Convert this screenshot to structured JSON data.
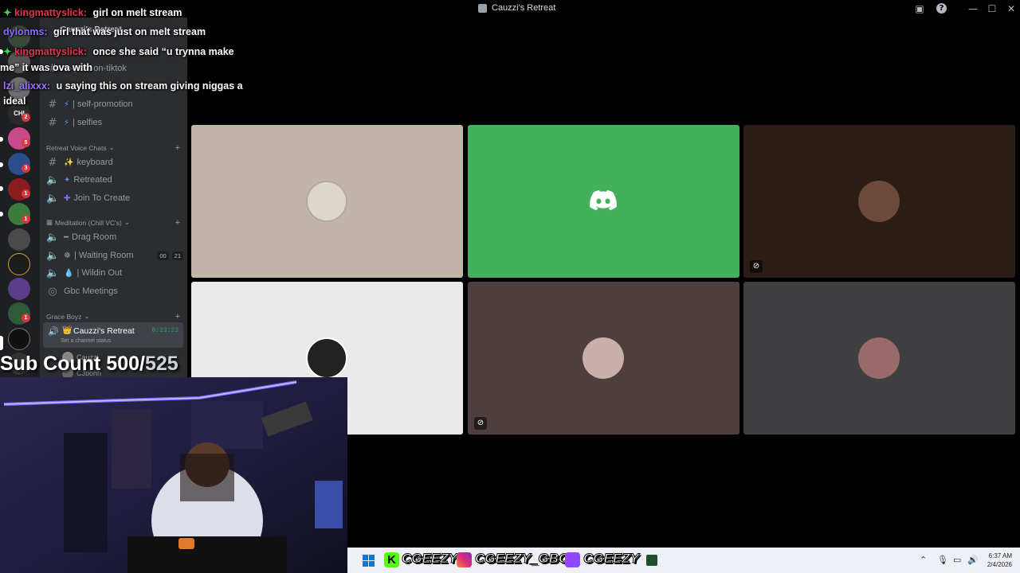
{
  "window": {
    "title": "Cauzzi's Retreat",
    "controls": {
      "minimize": "—",
      "maximize": "☐",
      "close": "✕"
    }
  },
  "rail": {
    "badges": [
      "2",
      "5",
      "3",
      "1",
      "1",
      "1"
    ]
  },
  "sidebar": {
    "server_name": "Cauzzi's Retreat",
    "channels_top": [
      {
        "label": "to-post-on-tiktok"
      },
      {
        "label": "| self-promotion"
      },
      {
        "label": "| selfies"
      }
    ],
    "category_voice": "Retreat Voice Chats",
    "voice_channels": [
      {
        "label": "keyboard"
      },
      {
        "label": "Retreated"
      },
      {
        "label": "Join To Create"
      }
    ],
    "category_meditation": "Meditation (Chill VC's)",
    "meditation_channels": [
      {
        "label": "Drag Room"
      },
      {
        "label": "| Waiting Room",
        "count_a": "00",
        "count_b": "21"
      },
      {
        "label": "| Wildin Out"
      },
      {
        "label": "Gbc Meetings"
      }
    ],
    "category_grace": "Grace Boyz",
    "active_channel": {
      "label": "Cauzzi's Retreat",
      "timer": "8:23:23",
      "status": "Set a channel status"
    },
    "members": [
      "Cauzzi",
      "CJbohh"
    ]
  },
  "chat": [
    {
      "user": "kingmattyslick:",
      "msg": "girl on melt stream",
      "color": "#e8334d"
    },
    {
      "user": "dylonms:",
      "msg": "girl that was just on melt stream",
      "color": "#8b6cff"
    },
    {
      "user": "kingmattyslick:",
      "msg": "once she said “u trynna make",
      "color": "#e8334d"
    },
    {
      "user": "",
      "msg": "me” it was ova with",
      "color": "#ffffff"
    },
    {
      "user": "lzi_alixxx:",
      "msg": "u saying this on stream giving niggas a",
      "color": "#9a74ff"
    },
    {
      "user": "",
      "msg": "ideal",
      "color": "#ffffff"
    }
  ],
  "overlay": {
    "sub_count_label": "Sub Count 500/",
    "sub_count_goal": "525"
  },
  "taskbar": {
    "kick": "CGEEZY",
    "instagram": "CGEEZY_GBC",
    "twitch": "CGEEZY",
    "time": "6:37 AM",
    "date": "2/4/2026"
  },
  "colors": {
    "discord_green": "#43b05c",
    "tile_beige": "#c0b5a8",
    "tile_brown": "#2b1d16",
    "tile_light": "#eaeaea",
    "tile_mauve": "#4e3f3e",
    "tile_gray": "#3f3f41"
  }
}
